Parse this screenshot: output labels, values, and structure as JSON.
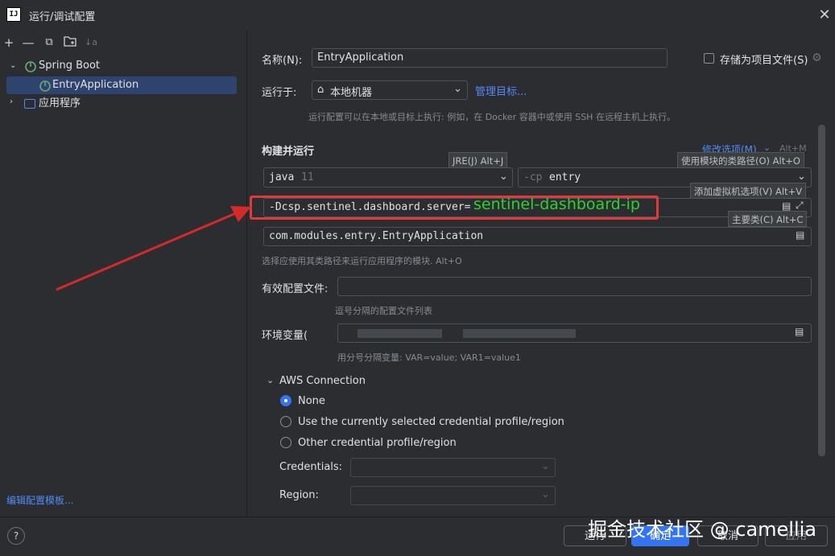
{
  "window": {
    "title": "运行/调试配置",
    "logo": "IJ"
  },
  "toolbar": {
    "icons": [
      "add-icon",
      "remove-icon",
      "copy-icon",
      "new-folder-icon",
      "sort-icon"
    ],
    "add": "+",
    "remove": "—",
    "copy": "⧉",
    "folder": "🗀",
    "sort": "↓a"
  },
  "tree": {
    "spring_boot": "Spring Boot",
    "entry_app": "EntryApplication",
    "app_programs": "应用程序"
  },
  "edit_templates": "编辑配置模板...",
  "form": {
    "name_label": "名称(N):",
    "name_value": "EntryApplication",
    "store_as_project_file": "存储为项目文件(S)",
    "run_on_label": "运行于:",
    "run_on_value": "本地机器",
    "manage_targets": "管理目标...",
    "run_on_hint": "运行配置可以在本地或目标上执行: 例如，在 Docker 容器中或使用 SSH 在远程主机上执行。",
    "build_run_label": "构建并运行",
    "modify_options": "修改选项(M)",
    "modify_options_shortcut": "Alt+M",
    "jre_value": "java",
    "jre_version": "11",
    "cp_prefix": "-cp",
    "cp_value": "entry",
    "vm_options_value": "-Dcsp.sentinel.dashboard.server=",
    "vm_options_overlay": "sentinel-dashboard-ip",
    "main_class_value": "com.modules.entry.EntryApplication",
    "main_class_hint": "选择应使用其类路径来运行应用程序的模块. Alt+O",
    "active_profiles_label": "有效配置文件:",
    "active_profiles_value": "",
    "active_profiles_hint": "逗号分隔的配置文件列表",
    "env_label": "环境变量(",
    "env_hint": "用分号分隔变量: VAR=value; VAR1=value1"
  },
  "tooltips": {
    "jre": "JRE(J) Alt+J",
    "module_cp": "使用模块的类路径(O) Alt+O",
    "vm_options": "添加虚拟机选项(V) Alt+V",
    "main_class": "主要类(C) Alt+C"
  },
  "aws": {
    "section_label": "AWS Connection",
    "options": [
      "None",
      "Use the currently selected credential profile/region",
      "Other credential profile/region"
    ],
    "selected_index": 0,
    "credentials_label": "Credentials:",
    "region_label": "Region:"
  },
  "buttons": {
    "run": "运行",
    "ok": "确定",
    "cancel": "取消",
    "apply": "应用"
  },
  "watermark": "掘金技术社区 @ camellia",
  "colors": {
    "accent": "#3574f0",
    "link": "#548af7",
    "highlight_box": "#e03b3b",
    "overlay_text": "#2fd12f"
  }
}
